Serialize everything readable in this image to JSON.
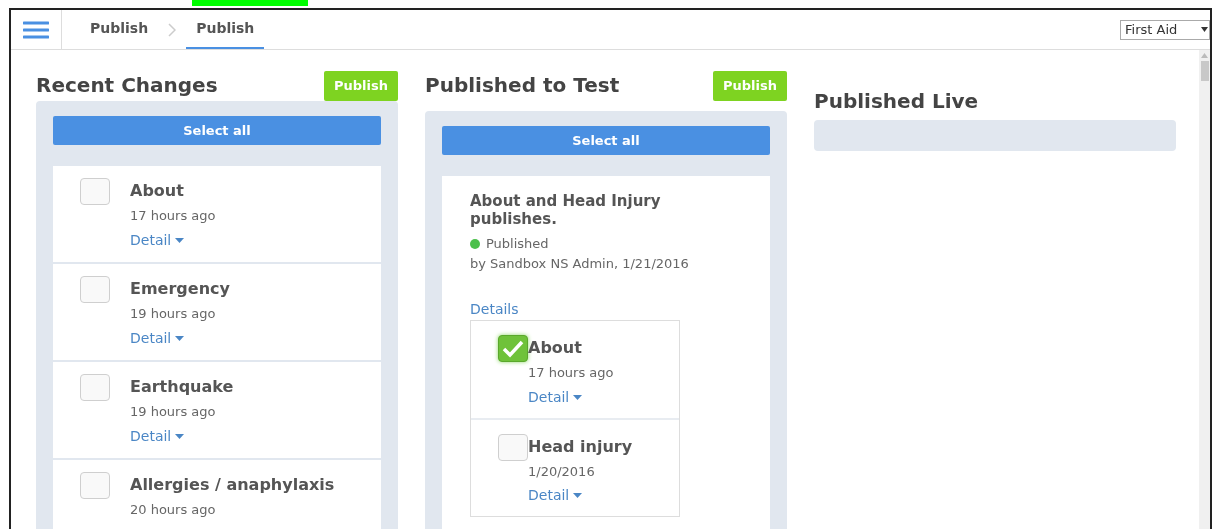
{
  "breadcrumbs": [
    {
      "label": "Publish",
      "selected": false
    },
    {
      "label": "Publish",
      "selected": true
    }
  ],
  "project_select": {
    "value": "First Aid"
  },
  "recent_changes": {
    "title": "Recent Changes",
    "publish_button": "Publish",
    "select_all": "Select all",
    "items": [
      {
        "name": "About",
        "time": "17 hours ago",
        "detail": "Detail",
        "checked": false
      },
      {
        "name": "Emergency",
        "time": "19 hours ago",
        "detail": "Detail",
        "checked": false
      },
      {
        "name": "Earthquake",
        "time": "19 hours ago",
        "detail": "Detail",
        "checked": false
      },
      {
        "name": "Allergies / anaphylaxis",
        "time": "20 hours ago",
        "checked": false
      }
    ]
  },
  "published_to_test": {
    "title": "Published to Test",
    "publish_button": "Publish",
    "select_all": "Select all",
    "publishes": [
      {
        "title": "About and Head Injury publishes.",
        "status": {
          "label": "Published",
          "color": "#4cc04c"
        },
        "byline": "by Sandbox NS Admin, 1/21/2016",
        "details_link": "Details",
        "items": [
          {
            "name": "About",
            "time": "17 hours ago",
            "detail": "Detail",
            "checked": true
          },
          {
            "name": "Head injury",
            "time": "1/20/2016",
            "detail": "Detail",
            "checked": false
          }
        ]
      }
    ]
  },
  "published_live": {
    "title": "Published Live"
  }
}
